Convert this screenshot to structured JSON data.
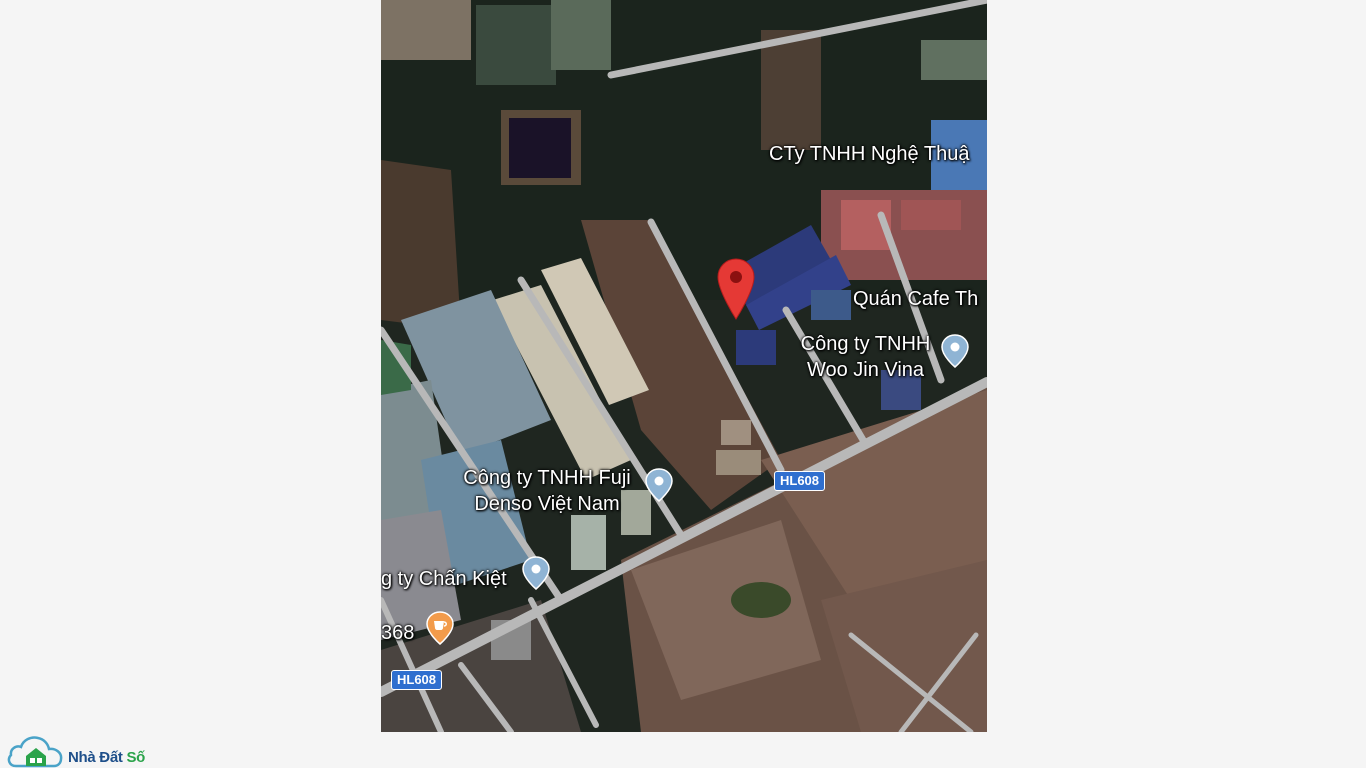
{
  "map": {
    "labels": {
      "company_nghe_thuat": "CTy TNHH Nghệ Thuậ",
      "quan_cafe": "Quán Cafe Th",
      "woo_jin_line1": "Công ty TNHH",
      "woo_jin_line2": "Woo Jin Vina",
      "fuji_line1": "Công ty TNHH Fuji",
      "fuji_line2": "Denso Việt Nam",
      "chan_kiet": "g ty Chấn Kiệt",
      "cafe_368": "368"
    },
    "road_shields": {
      "hl608_a": "HL608",
      "hl608_b": "HL608"
    },
    "markers": {
      "selected_pin_color": "#e53935",
      "poi_pin_color": "#8fb4d4",
      "cafe_pin_color": "#f29b4b"
    }
  },
  "branding": {
    "logo_part1": "Nhà Đất",
    "logo_part2": "Số"
  }
}
